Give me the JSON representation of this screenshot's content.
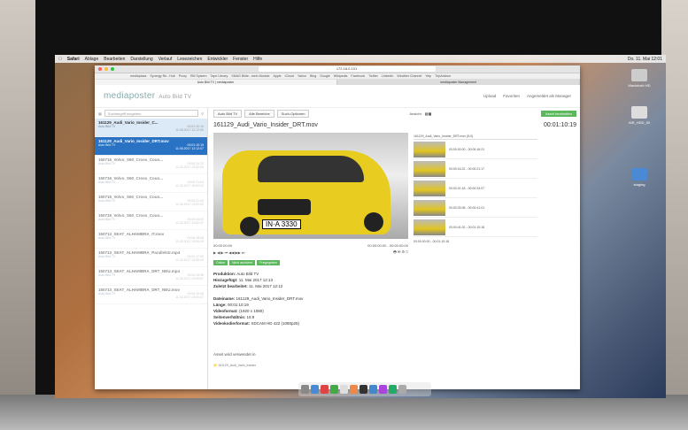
{
  "mac_menubar": {
    "items": [
      "Safari",
      "Ablage",
      "Bearbeiten",
      "Darstellung",
      "Verlauf",
      "Lesezeichen",
      "Entwickler",
      "Fenster",
      "Hilfe"
    ],
    "clock": "Do. 11. Mai 12:01"
  },
  "browser": {
    "url": "172.18.0.101",
    "bookmarks": [
      "mediaplaza",
      "Synergy Re...Hub",
      "Proxy",
      "RM System",
      "Tape Library",
      "SMAG Bilde...mein Module",
      "Apple",
      "iCloud",
      "Yahoo",
      "Bing",
      "Google",
      "Wikipedia",
      "Facebook",
      "Twitter",
      "LinkedIn",
      "Weather Channel",
      "Yelp",
      "TripAdvisor"
    ],
    "tabs": [
      "Auto Bild TV | mediaposter",
      "mediaposter Management"
    ]
  },
  "app": {
    "logo": "mediaposter",
    "logo_sub": "Auto Bild TV",
    "nav": [
      "Upload",
      "Favoriten",
      "Angemeldet als Manager"
    ],
    "search_placeholder": "Suchbegriff eingeben",
    "toolbar": {
      "btn1": "Auto Bild TV",
      "btn2": "Alle Bereiche",
      "btn3": "Such-Optionen",
      "ansicht": "Ansicht:",
      "green": "Asset bearbeiten"
    }
  },
  "list": [
    {
      "title": "161129_Audi_Vario_Insider_C...",
      "sub": "Auto Bild TV",
      "dur": "00:01:10:19",
      "date": "11.05.2017 12:12:00",
      "state": "sel1"
    },
    {
      "title": "161129_Audi_Vario_Insider_DRT.mov",
      "sub": "Auto Bild TV",
      "dur": "00:01:10:19",
      "date": "11.05.2017 12:12:07",
      "state": "sel2"
    },
    {
      "title": "150716_Volvo_S60_Cross_Coun...",
      "sub": "Auto Bild TV",
      "dur": "00:00:13:13",
      "date": "11.02.2017 19:02:00",
      "state": "faded"
    },
    {
      "title": "150716_Volvo_S60_Cross_Coun...",
      "sub": "Auto Bild TV",
      "dur": "00:00:21:04",
      "date": "11.02.2017 19:02:02",
      "state": "faded"
    },
    {
      "title": "150716_Volvo_S60_Cross_Coun...",
      "sub": "Auto Bild TV",
      "dur": "00:00:21:04",
      "date": "11.02.2017 19:02:02",
      "state": "faded"
    },
    {
      "title": "150716_Volvo_S60_Cross_Coun...",
      "sub": "Auto Bild TV",
      "dur": "00:00:34:00",
      "date": "11.02.2017 19:02:07",
      "state": "faded"
    },
    {
      "title": "150713_SEAT_ALHAMBRA_IT.mov",
      "sub": "Auto Bild TV",
      "dur": "00:04:18:08",
      "date": "11.02.2017 19:00:09",
      "state": "faded"
    },
    {
      "title": "150713_SEAT_ALHAMBRA_Parallelstr.mp4",
      "sub": "Auto Bild TV",
      "dur": "00:01:17:00",
      "date": "11.02.2017 19:00:09",
      "state": "faded"
    },
    {
      "title": "150713_SEAT_ALHAMBRA_DRT_NEU.mp4",
      "sub": "Auto Bild TV",
      "dur": "00:04:19:08",
      "date": "11.02.2017 19:00:07",
      "state": "faded"
    },
    {
      "title": "150713_SEAT_ALHAMBRA_DRT_NEU.mov",
      "sub": "Auto Bild TV",
      "dur": "00:04:19:08",
      "date": "11.02.2017 19:00:07",
      "state": "faded"
    }
  ],
  "detail": {
    "title": "161129_Audi_Vario_Insider_DRT.mov",
    "duration": "00:01:10:19",
    "plate": "IN·A 3330",
    "timecode_left": "00:00:00:00",
    "timecode_right": "00:00:00:00 - 00:00:00:00",
    "badges": [
      "Online",
      "Nicht archiviert",
      "Freigegeben"
    ],
    "meta": [
      {
        "k": "Produktion:",
        "v": "Auto Bild TV"
      },
      {
        "k": "Hinzugefügt:",
        "v": "11. Mai 2017 12:13"
      },
      {
        "k": "Zuletzt bearbeitet:",
        "v": "11. Mai 2017 12:12"
      },
      {
        "k": "",
        "v": ""
      },
      {
        "k": "Dateiname:",
        "v": "161129_Audi_Vario_Insider_DRT.mov"
      },
      {
        "k": "Länge:",
        "v": "00:01:10:19"
      },
      {
        "k": "Videoformat:",
        "v": "(1920 x 1080)"
      },
      {
        "k": "Seitenverhältnis:",
        "v": "16:9"
      },
      {
        "k": "Videokodierformat:",
        "v": "XDCAM HD 422 (1080p25)"
      }
    ],
    "usage_title": "Asset wird verwendet in",
    "usage_file": "161129_Audi_Vario_Insider"
  },
  "segments": {
    "header": "161129_Audi_Vario_Insider_DRT.mov (5-0)",
    "items": [
      "00:00:00:00 - 00:00:16:21",
      "00:00:16:22 - 00:00:21:17",
      "00:00:21:18 - 00:00:33:07",
      "00:00:33:08 - 00:00:41:01",
      "00:00:41:02 - 00:01:10:18"
    ],
    "footer": "00:00:00:00 - 00:01:10:18"
  },
  "desktop_icons": [
    "Macintosh HD",
    "AIR_HDD_50",
    "staging"
  ]
}
